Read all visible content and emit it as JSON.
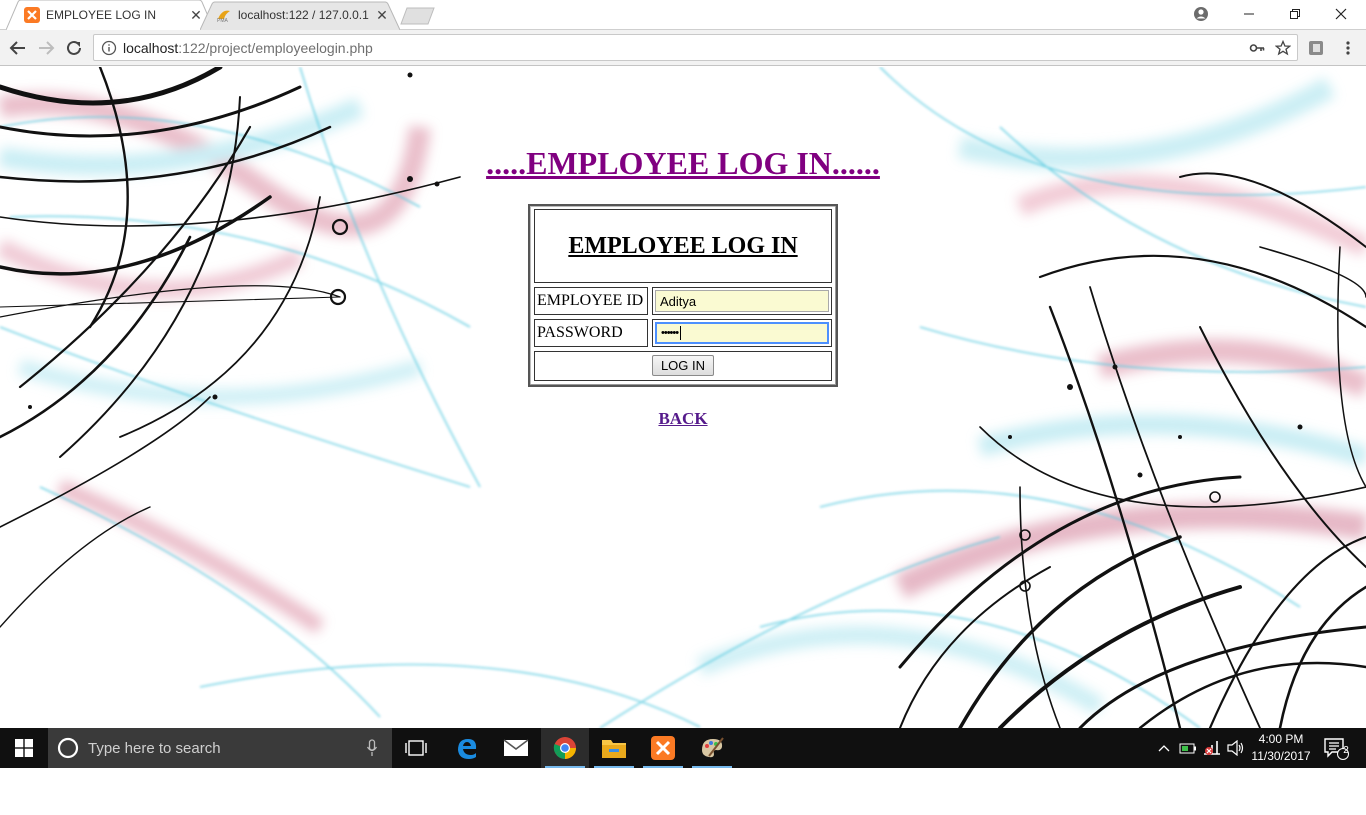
{
  "browser": {
    "tabs": [
      {
        "title": "EMPLOYEE LOG IN",
        "favicon": "xampp-icon",
        "active": true
      },
      {
        "title": "localhost:122 / 127.0.0.1",
        "favicon": "phpmyadmin-icon",
        "active": false
      }
    ],
    "url": {
      "host": "localhost",
      "path": ":122/project/employeelogin.php"
    }
  },
  "page": {
    "heading": ".....EMPLOYEE LOG IN......",
    "form": {
      "title": "EMPLOYEE LOG IN",
      "employee_id_label": "EMPLOYEE ID",
      "employee_id_value": "Aditya",
      "password_label": "PASSWORD",
      "password_value": "••••••",
      "submit_label": "LOG IN"
    },
    "back_link": "BACK"
  },
  "taskbar": {
    "search_placeholder": "Type here to search",
    "time": "4:00 PM",
    "date": "11/30/2017",
    "notification_count": "2"
  },
  "colors": {
    "heading": "#800080",
    "link": "#551a8b",
    "autofill": "#fafad2",
    "focus": "#4d90fe",
    "taskbar": "#101010"
  }
}
